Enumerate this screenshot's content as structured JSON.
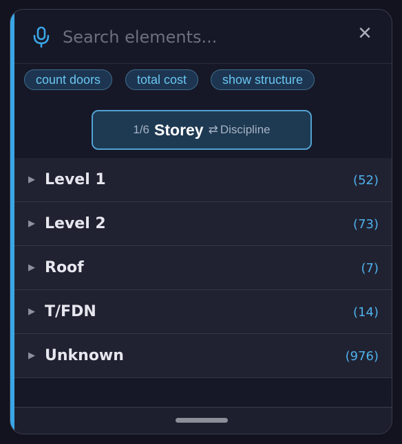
{
  "search": {
    "placeholder": "Search elements...",
    "value": ""
  },
  "icons": {
    "mic": "microphone-icon",
    "close": "close-icon",
    "caret": "caret-right-icon"
  },
  "close_glyph": "✕",
  "suggestions": [
    {
      "label": "count doors"
    },
    {
      "label": "total cost"
    },
    {
      "label": "show structure"
    }
  ],
  "grouping": {
    "index": "1/6",
    "current": "Storey",
    "swap_glyph": "⇄",
    "alternate": "Discipline"
  },
  "groups": [
    {
      "caret": "▶",
      "label": "Level 1",
      "count": "(52)"
    },
    {
      "caret": "▶",
      "label": "Level 2",
      "count": "(73)"
    },
    {
      "caret": "▶",
      "label": "Roof",
      "count": "(7)"
    },
    {
      "caret": "▶",
      "label": "T/FDN",
      "count": "(14)"
    },
    {
      "caret": "▶",
      "label": "Unknown",
      "count": "(976)"
    }
  ],
  "colors": {
    "accent": "#3aa6e6",
    "count": "#4fb1ec",
    "chip_text": "#6ac5f2",
    "panel_bg": "#171827"
  }
}
